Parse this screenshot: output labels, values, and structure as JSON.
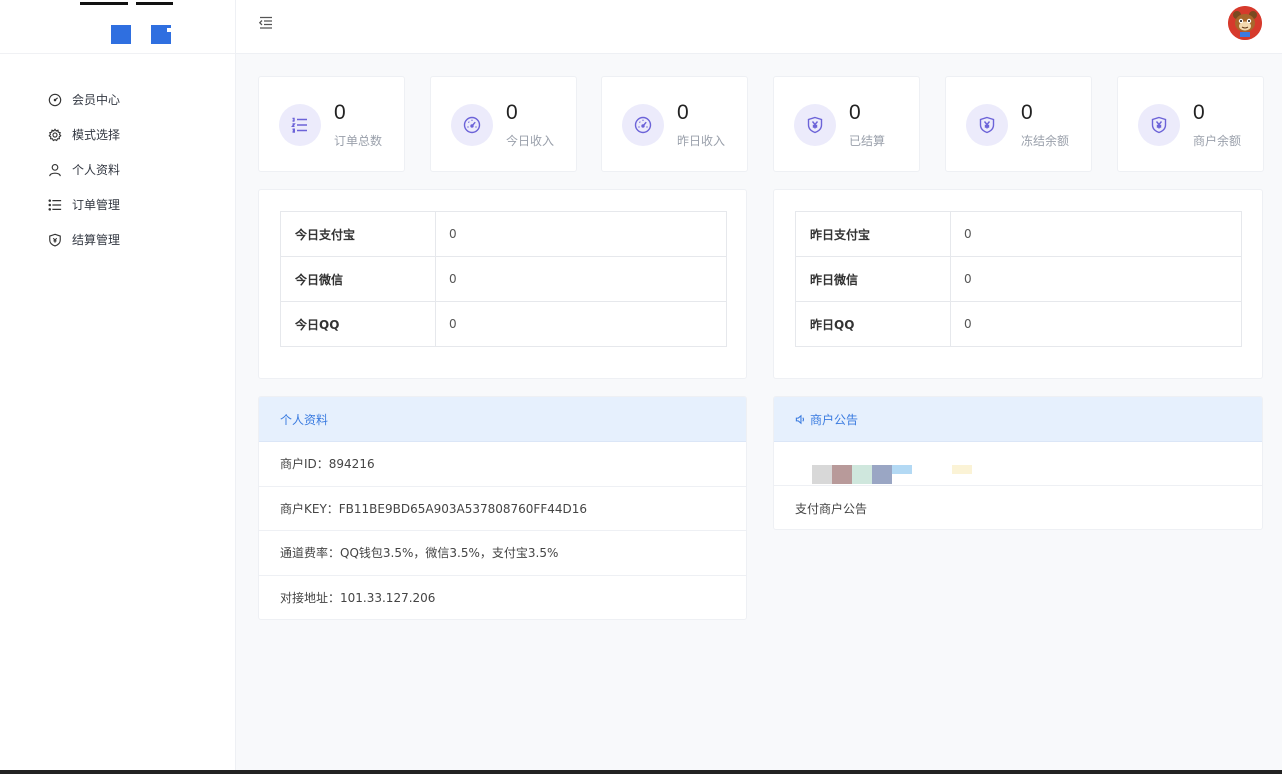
{
  "nav": {
    "items": [
      {
        "label": "会员中心",
        "icon": "dashboard-icon"
      },
      {
        "label": "模式选择",
        "icon": "gear-icon"
      },
      {
        "label": "个人资料",
        "icon": "user-icon"
      },
      {
        "label": "订单管理",
        "icon": "list-icon"
      },
      {
        "label": "结算管理",
        "icon": "shield-icon"
      }
    ]
  },
  "stats": [
    {
      "value": "0",
      "label": "订单总数",
      "icon": "list-icon"
    },
    {
      "value": "0",
      "label": "今日收入",
      "icon": "gauge-icon"
    },
    {
      "value": "0",
      "label": "昨日收入",
      "icon": "gauge-icon"
    },
    {
      "value": "0",
      "label": "已结算",
      "icon": "yen-icon"
    },
    {
      "value": "0",
      "label": "冻结余额",
      "icon": "yen-icon"
    },
    {
      "value": "0",
      "label": "商户余额",
      "icon": "yen-icon"
    }
  ],
  "today": [
    {
      "label": "今日支付宝",
      "value": "0"
    },
    {
      "label": "今日微信",
      "value": "0"
    },
    {
      "label": "今日QQ",
      "value": "0"
    }
  ],
  "yesterday": [
    {
      "label": "昨日支付宝",
      "value": "0"
    },
    {
      "label": "昨日微信",
      "value": "0"
    },
    {
      "label": "昨日QQ",
      "value": "0"
    }
  ],
  "profile": {
    "title": "个人资料",
    "rows": [
      "商户ID：894216",
      "商户KEY：FB11BE9BD65A903A537808760FF44D16",
      "通道费率：QQ钱包3.5%，微信3.5%，支付宝3.5%",
      "对接地址：101.33.127.206"
    ]
  },
  "notice": {
    "title": "商户公告",
    "icon": "speaker-icon",
    "text": "支付商户公告"
  },
  "colors": {
    "accent": "#3a7be0",
    "icon_purple": "#6c63d8",
    "icon_bg": "#ecebfb",
    "panel_head": "#e6f0fd"
  }
}
